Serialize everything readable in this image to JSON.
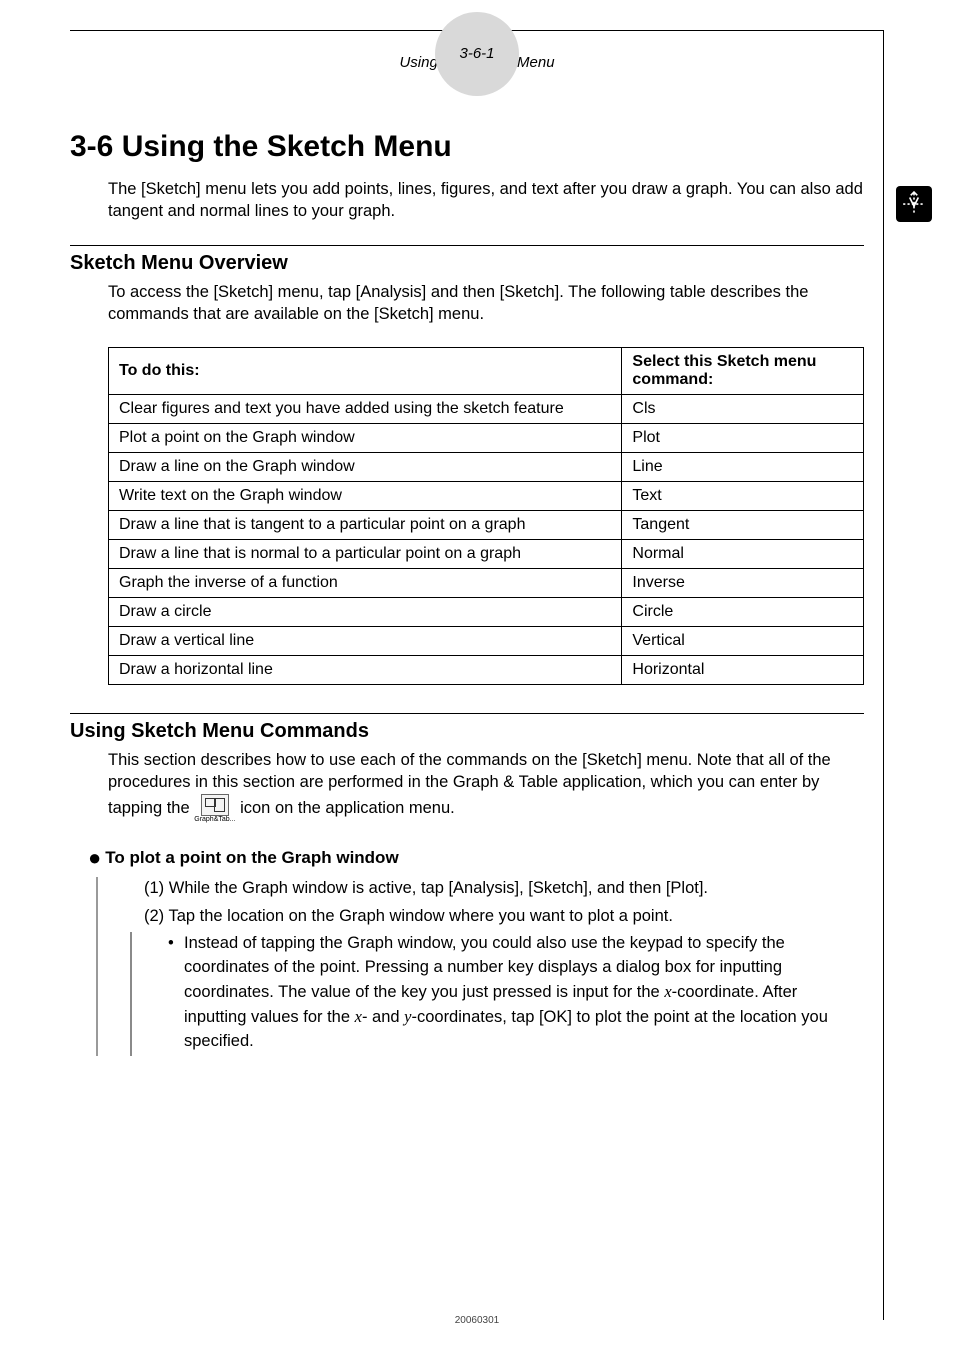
{
  "header": {
    "page_num": "3-6-1",
    "page_title": "Using the Sketch Menu"
  },
  "title": "3-6  Using the Sketch Menu",
  "intro": "The [Sketch] menu lets you add points, lines, figures, and text after you draw a graph. You can also add tangent and normal lines to your graph.",
  "overview": {
    "heading": "Sketch Menu Overview",
    "desc": "To access the [Sketch] menu, tap [Analysis] and then [Sketch]. The following table describes the commands that are available on the [Sketch] menu.",
    "col1": "To do this:",
    "col2": "Select this Sketch menu command:",
    "rows": [
      {
        "a": "Clear figures and text you have added using the sketch feature",
        "b": "Cls"
      },
      {
        "a": "Plot a point on the Graph window",
        "b": "Plot"
      },
      {
        "a": "Draw a line on the Graph window",
        "b": "Line"
      },
      {
        "a": "Write text on the Graph window",
        "b": "Text"
      },
      {
        "a": "Draw a line that is tangent to a particular point on a graph",
        "b": "Tangent"
      },
      {
        "a": "Draw a line that is normal to a particular point on a graph",
        "b": "Normal"
      },
      {
        "a": "Graph the inverse of a function",
        "b": "Inverse"
      },
      {
        "a": "Draw a circle",
        "b": "Circle"
      },
      {
        "a": "Draw a vertical line",
        "b": "Vertical"
      },
      {
        "a": "Draw a horizontal line",
        "b": "Horizontal"
      }
    ]
  },
  "commands": {
    "heading": "Using Sketch Menu Commands",
    "desc_pre": "This section describes how to use each of the commands on the [Sketch] menu. Note that all of the procedures in this section are performed in the Graph & Table application, which you can enter by tapping the ",
    "icon_label": "Graph&Tab...",
    "desc_post": " icon on the application menu.",
    "plot": {
      "heading": "To plot a point on the Graph window",
      "step1": "(1) While the Graph window is active, tap [Analysis], [Sketch], and then [Plot].",
      "step2": "(2) Tap the location on the Graph window where you want to plot a point.",
      "sub_a": "Instead of tapping the Graph window, you could also use the keypad to specify the coordinates of the point. Pressing a number key displays a dialog box for inputting coordinates. The value of the key you just pressed is input for the ",
      "sub_b": "-coordinate. After inputting values for the ",
      "sub_c": "- and ",
      "sub_d": "-coordinates, tap [OK] to plot the point at the location you specified.",
      "x": "x",
      "y": "y"
    }
  },
  "footer": "20060301"
}
